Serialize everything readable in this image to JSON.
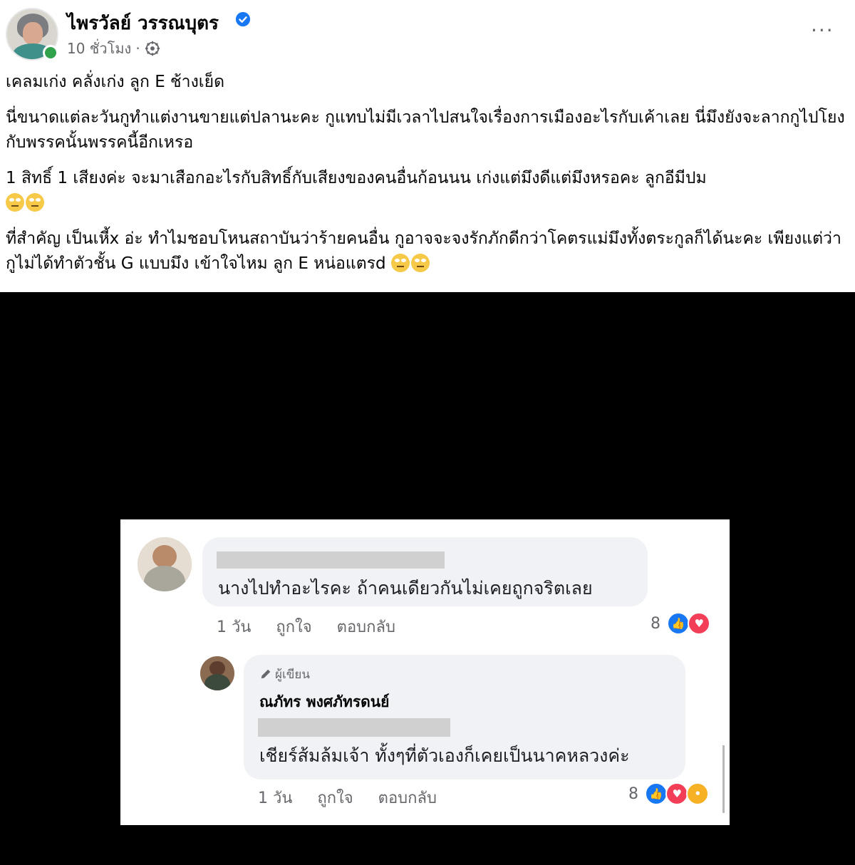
{
  "post": {
    "author_name": "ไพรวัลย์ วรรณบุตร",
    "time": "10 ชั่วโมง",
    "separator": "·",
    "paragraphs": [
      "เคลมเก่ง คลั่งเก่ง ลูก E ช้างเย็ด",
      "นี่ขนาดแต่ละวันกูทำแต่งานขายแต่ปลานะคะ  กูแทบไม่มีเวลาไปสนใจเรื่องการเมืองอะไรกับเค้าเลย  นี่มึงยังจะลากกูไปโยงกับพรรคนั้นพรรคนี้อีกเหรอ",
      "1 สิทธิ์ 1 เสียงค่ะ  จะมาเสือกอะไรกับสิทธิ์กับเสียงของคนอื่นก้อนนน เก่งแต่มึงดีแต่มึงหรอคะ ลูกอีมีปม",
      "ที่สำคัญ เป็นเหี้x อ่ะ ทำไมชอบโหนสถาบันว่าร้ายคนอื่น กูอาจจะจงรักภักดีกว่าโคตรแม่มึงทั้งตระกูลก็ได้นะคะ เพียงแต่ว่า กูไม่ได้ทำตัวชั้น G แบบมึง  เข้าใจไหม ลูก E หน่อแตรd"
    ],
    "icons": {
      "verified": "verified-badge-icon",
      "privacy": "public-globe-icon",
      "more": "more-options-icon",
      "emoji": "eye-roll-emoji"
    },
    "more_label": "···"
  },
  "comments": [
    {
      "text": "นางไปทำอะไรคะ ถ้าคนเดียวกันไม่เคยถูกจริตเลย",
      "time": "1 วัน",
      "like_label": "ถูกใจ",
      "reply_label": "ตอบกลับ",
      "reaction_count": "8"
    },
    {
      "badge": "ผู้เขียน",
      "name": "ณภัทร พงศภัทรดนย์",
      "text": "เชียร์ส้มล้มเจ้า ทั้งๆที่ตัวเองก็เคยเป็นนาคหลวงค่ะ",
      "time": "1 วัน",
      "like_label": "ถูกใจ",
      "reply_label": "ตอบกลับ",
      "reaction_count": "8"
    }
  ],
  "colors": {
    "like": "#1877f2",
    "love": "#f33e58",
    "online": "#31a24c",
    "verified": "#1877f2"
  }
}
